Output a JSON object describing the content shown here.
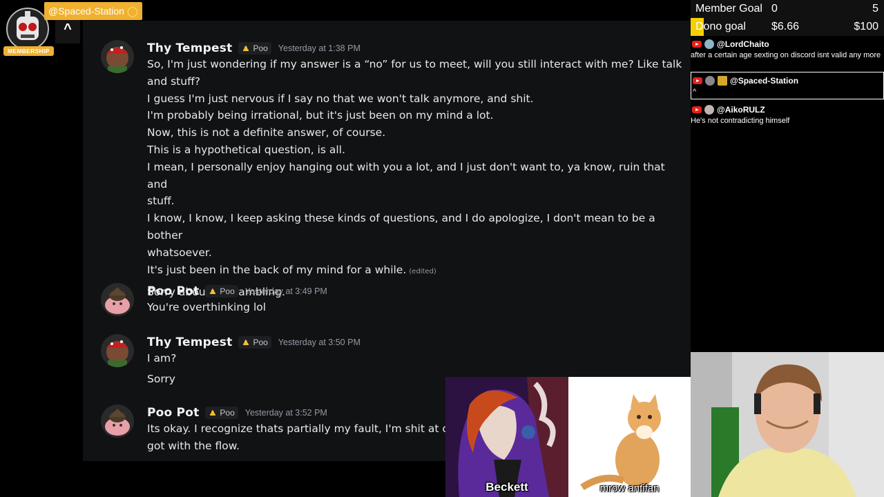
{
  "channel": {
    "name": "@Spaced-Station",
    "caret": "^",
    "membership": "MEMBERSHIP"
  },
  "goals": {
    "member": {
      "label": "Member Goal",
      "current": "0",
      "target": "5",
      "progress": 0
    },
    "dono": {
      "label": "Dono goal",
      "current": "$6.66",
      "target": "$100",
      "progress": 0.0666
    },
    "fill_color": "#f5d000"
  },
  "livechat": [
    {
      "user": "@LordChaito",
      "text": "after a certain age sexting on discord isnt valid any more",
      "highlight": false
    },
    {
      "user": "@Spaced-Station",
      "text": "^",
      "highlight": true
    },
    {
      "user": "@AikoRULZ",
      "text": "He's not contradicting himself",
      "highlight": false
    }
  ],
  "messages": [
    {
      "author": "Thy Tempest",
      "tag": "Poo",
      "time": "Yesterday at 1:38 PM",
      "lines": [
        "So, I'm just wondering if my answer is a “no” for us to meet, will you still interact with me? Like talk",
        "and stuff?",
        "I guess I'm just nervous if I say no that we won't talk anymore, and shit.",
        "I'm probably being irrational, but it's just been on my mind a lot.",
        "Now, this is not a definite answer, of course.",
        "This is a hypothetical question, is all.",
        "I mean, I personally enjoy hanging out with you a lot, and I just don't want to, ya know, ruin that and",
        "stuff.",
        "I know, I know, I keep asking these kinds of questions, and I do apologize, I don't mean to be a bother",
        "whatsoever.",
        "It's just been in the back of my mind for a while.",
        "Sorry about the rambling."
      ],
      "edited": "(edited)"
    },
    {
      "author": "Poo Pot",
      "tag": "Poo",
      "time": "Yesterday at 3:49 PM",
      "lines": [
        "You're overthinking lol"
      ]
    },
    {
      "author": "Thy Tempest",
      "tag": "Poo",
      "time": "Yesterday at 3:50 PM",
      "lines": [
        "I am?",
        "Sorry"
      ]
    },
    {
      "author": "Poo Pot",
      "tag": "Poo",
      "time": "Yesterday at 3:52 PM",
      "lines": [
        "Its okay. I recognize thats partially my fault, I'm shit at co",
        "got with the flow."
      ]
    }
  ],
  "overlays": {
    "beckett": "Beckett",
    "cat": "mrow antifan"
  }
}
